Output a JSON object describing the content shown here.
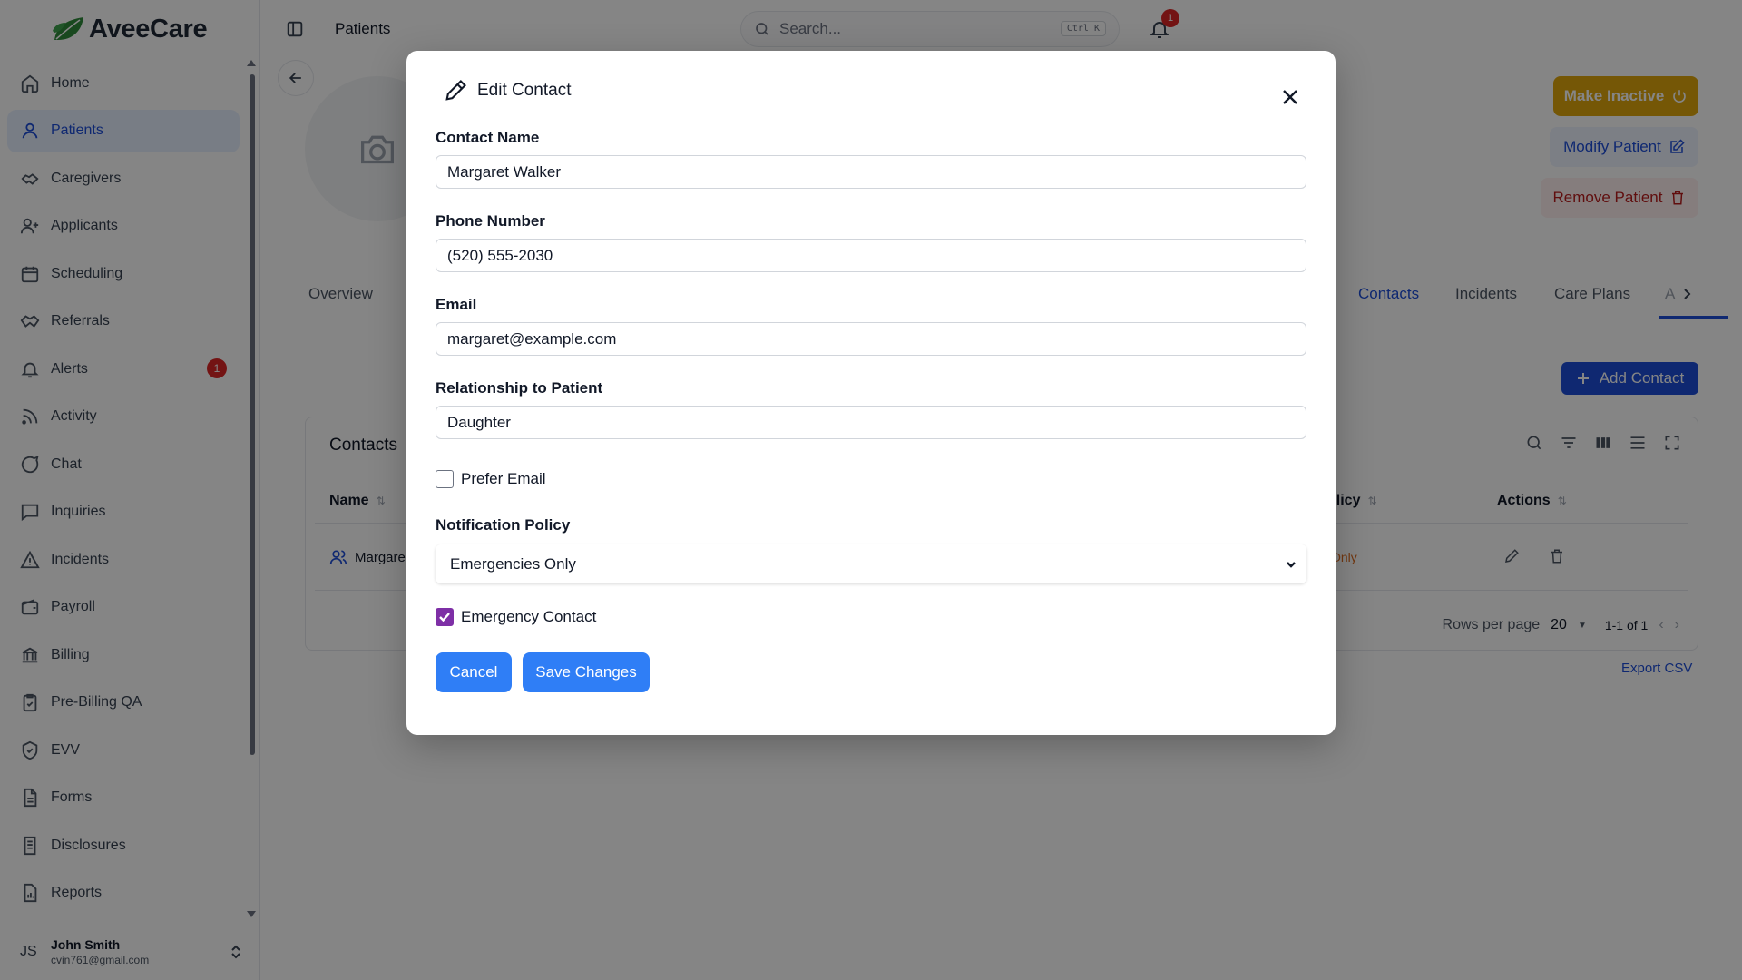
{
  "app": {
    "brand": "AveeCare",
    "accent": "#1d4ed8",
    "brand_green": "#2e8b3a"
  },
  "sidebar": {
    "items": [
      {
        "label": "Home",
        "icon": "home-icon"
      },
      {
        "label": "Patients",
        "icon": "user-icon",
        "active": true
      },
      {
        "label": "Caregivers",
        "icon": "handshake-icon"
      },
      {
        "label": "Applicants",
        "icon": "user-plus-icon"
      },
      {
        "label": "Scheduling",
        "icon": "calendar-icon"
      },
      {
        "label": "Referrals",
        "icon": "handshake-icon"
      },
      {
        "label": "Alerts",
        "icon": "bell-icon",
        "badge": "1"
      },
      {
        "label": "Activity",
        "icon": "rss-icon"
      },
      {
        "label": "Chat",
        "icon": "chat-icon"
      },
      {
        "label": "Inquiries",
        "icon": "message-square-icon"
      },
      {
        "label": "Incidents",
        "icon": "alert-triangle-icon"
      },
      {
        "label": "Payroll",
        "icon": "wallet-icon"
      },
      {
        "label": "Billing",
        "icon": "bank-icon"
      },
      {
        "label": "Pre-Billing QA",
        "icon": "clipboard-check-icon"
      },
      {
        "label": "EVV",
        "icon": "shield-check-icon"
      },
      {
        "label": "Forms",
        "icon": "file-icon"
      },
      {
        "label": "Disclosures",
        "icon": "file-text-icon"
      },
      {
        "label": "Reports",
        "icon": "bar-chart-file-icon"
      }
    ],
    "user": {
      "initials": "JS",
      "name": "John Smith",
      "email": "cvin761@gmail.com"
    }
  },
  "header": {
    "breadcrumb": "Patients",
    "search_placeholder": "Search...",
    "search_shortcut": "Ctrl K",
    "notifications_count": "1"
  },
  "patient_page": {
    "actions": {
      "make_inactive": "Make Inactive",
      "modify": "Modify Patient",
      "remove": "Remove Patient"
    },
    "tabs": [
      {
        "label": "Overview"
      },
      {
        "label": "Contacts",
        "active": true
      },
      {
        "label": "Incidents"
      },
      {
        "label": "Care Plans"
      },
      {
        "label": "A"
      }
    ],
    "add_contact": "Add Contact",
    "contacts_table": {
      "title": "Contacts",
      "columns": {
        "name": "Name",
        "policy": "olicy",
        "actions": "Actions"
      },
      "rows": [
        {
          "name": "Margare",
          "policy": "Only"
        }
      ],
      "rows_per_page_label": "Rows per page",
      "rows_per_page_value": "20",
      "range": "1-1 of 1",
      "export": "Export CSV"
    }
  },
  "modal": {
    "title": "Edit Contact",
    "fields": {
      "contact_name": {
        "label": "Contact Name",
        "value": "Margaret Walker"
      },
      "phone": {
        "label": "Phone Number",
        "value": "(520) 555-2030"
      },
      "email": {
        "label": "Email",
        "value": "margaret@example.com"
      },
      "relationship": {
        "label": "Relationship to Patient",
        "value": "Daughter"
      }
    },
    "prefer_email": {
      "label": "Prefer Email",
      "checked": false
    },
    "notification_policy": {
      "label": "Notification Policy",
      "selected": "Emergencies Only"
    },
    "emergency_contact": {
      "label": "Emergency Contact",
      "checked": true
    },
    "buttons": {
      "cancel": "Cancel",
      "save": "Save Changes"
    }
  }
}
